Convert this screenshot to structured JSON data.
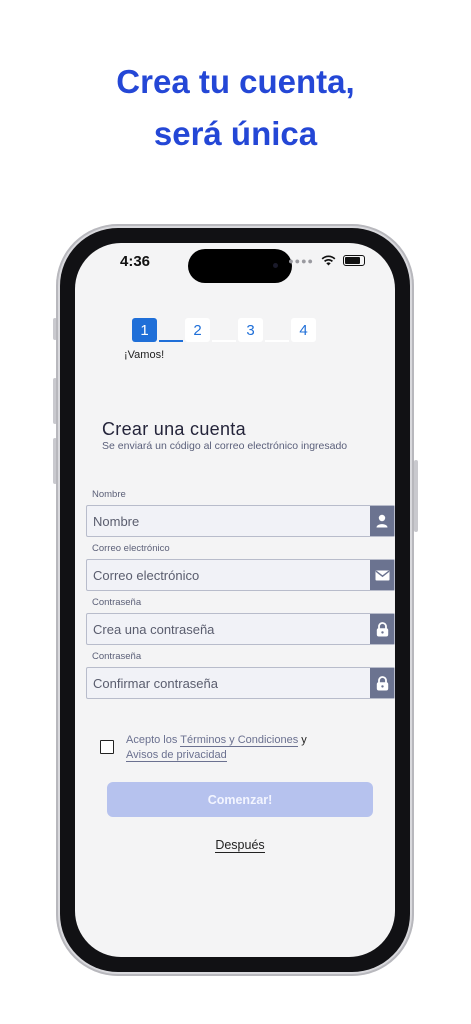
{
  "headline": {
    "line1": "Crea tu cuenta,",
    "line2": "será única"
  },
  "status": {
    "time": "4:36"
  },
  "stepper": {
    "steps": [
      "1",
      "2",
      "3",
      "4"
    ],
    "caption": "¡Vamos!"
  },
  "form": {
    "title": "Crear una cuenta",
    "subtitle": "Se enviará un código al correo electrónico ingresado",
    "fields": [
      {
        "label": "Nombre",
        "placeholder": "Nombre",
        "icon": "user-icon"
      },
      {
        "label": "Correo electrónico",
        "placeholder": "Correo electrónico",
        "icon": "mail-icon"
      },
      {
        "label": "Contraseña",
        "placeholder": "Crea una contraseña",
        "icon": "lock-icon"
      },
      {
        "label": "Contraseña",
        "placeholder": "Confirmar contraseña",
        "icon": "lock-icon"
      }
    ]
  },
  "terms": {
    "prefix": "Acepto los",
    "terms_link": "Términos y Condiciones",
    "connector": "y",
    "privacy_link": "Avisos de privacidad"
  },
  "buttons": {
    "start": "Comenzar!",
    "later": "Después"
  },
  "colors": {
    "accent": "#1f6fd8",
    "headline": "#2447d6",
    "button_disabled": "#b6c2ee",
    "icon_bg": "#6b7390"
  }
}
